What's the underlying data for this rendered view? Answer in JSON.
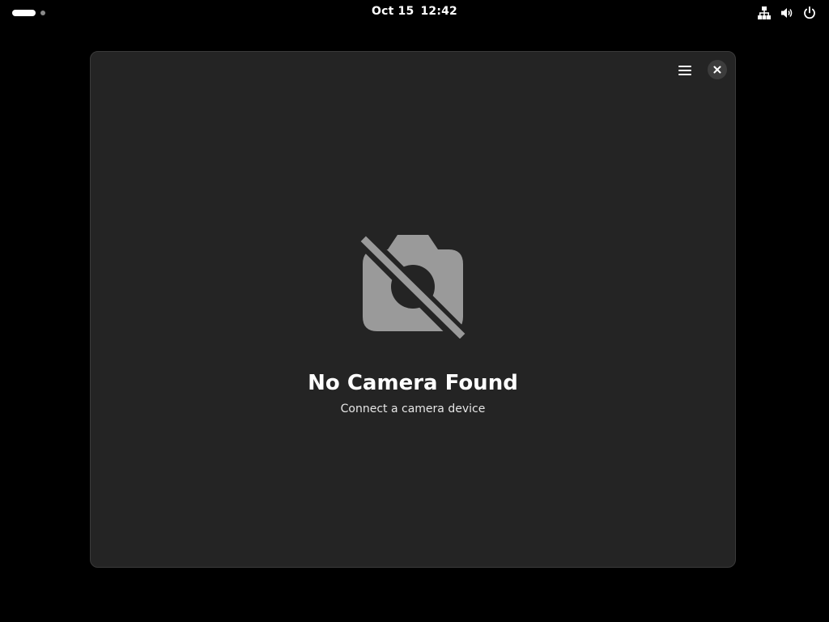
{
  "topbar": {
    "date": "Oct 15",
    "time": "12:42",
    "icons": [
      "network-icon",
      "volume-icon",
      "power-icon"
    ]
  },
  "window": {
    "menu_icon": "hamburger-menu-icon",
    "close_icon": "close-icon",
    "status": {
      "icon": "camera-disabled-icon",
      "title": "No Camera Found",
      "description": "Connect a camera device"
    }
  },
  "colors": {
    "background": "#000000",
    "window": "#242424",
    "icon_gray": "#9a9a9a",
    "text": "#ffffff"
  }
}
